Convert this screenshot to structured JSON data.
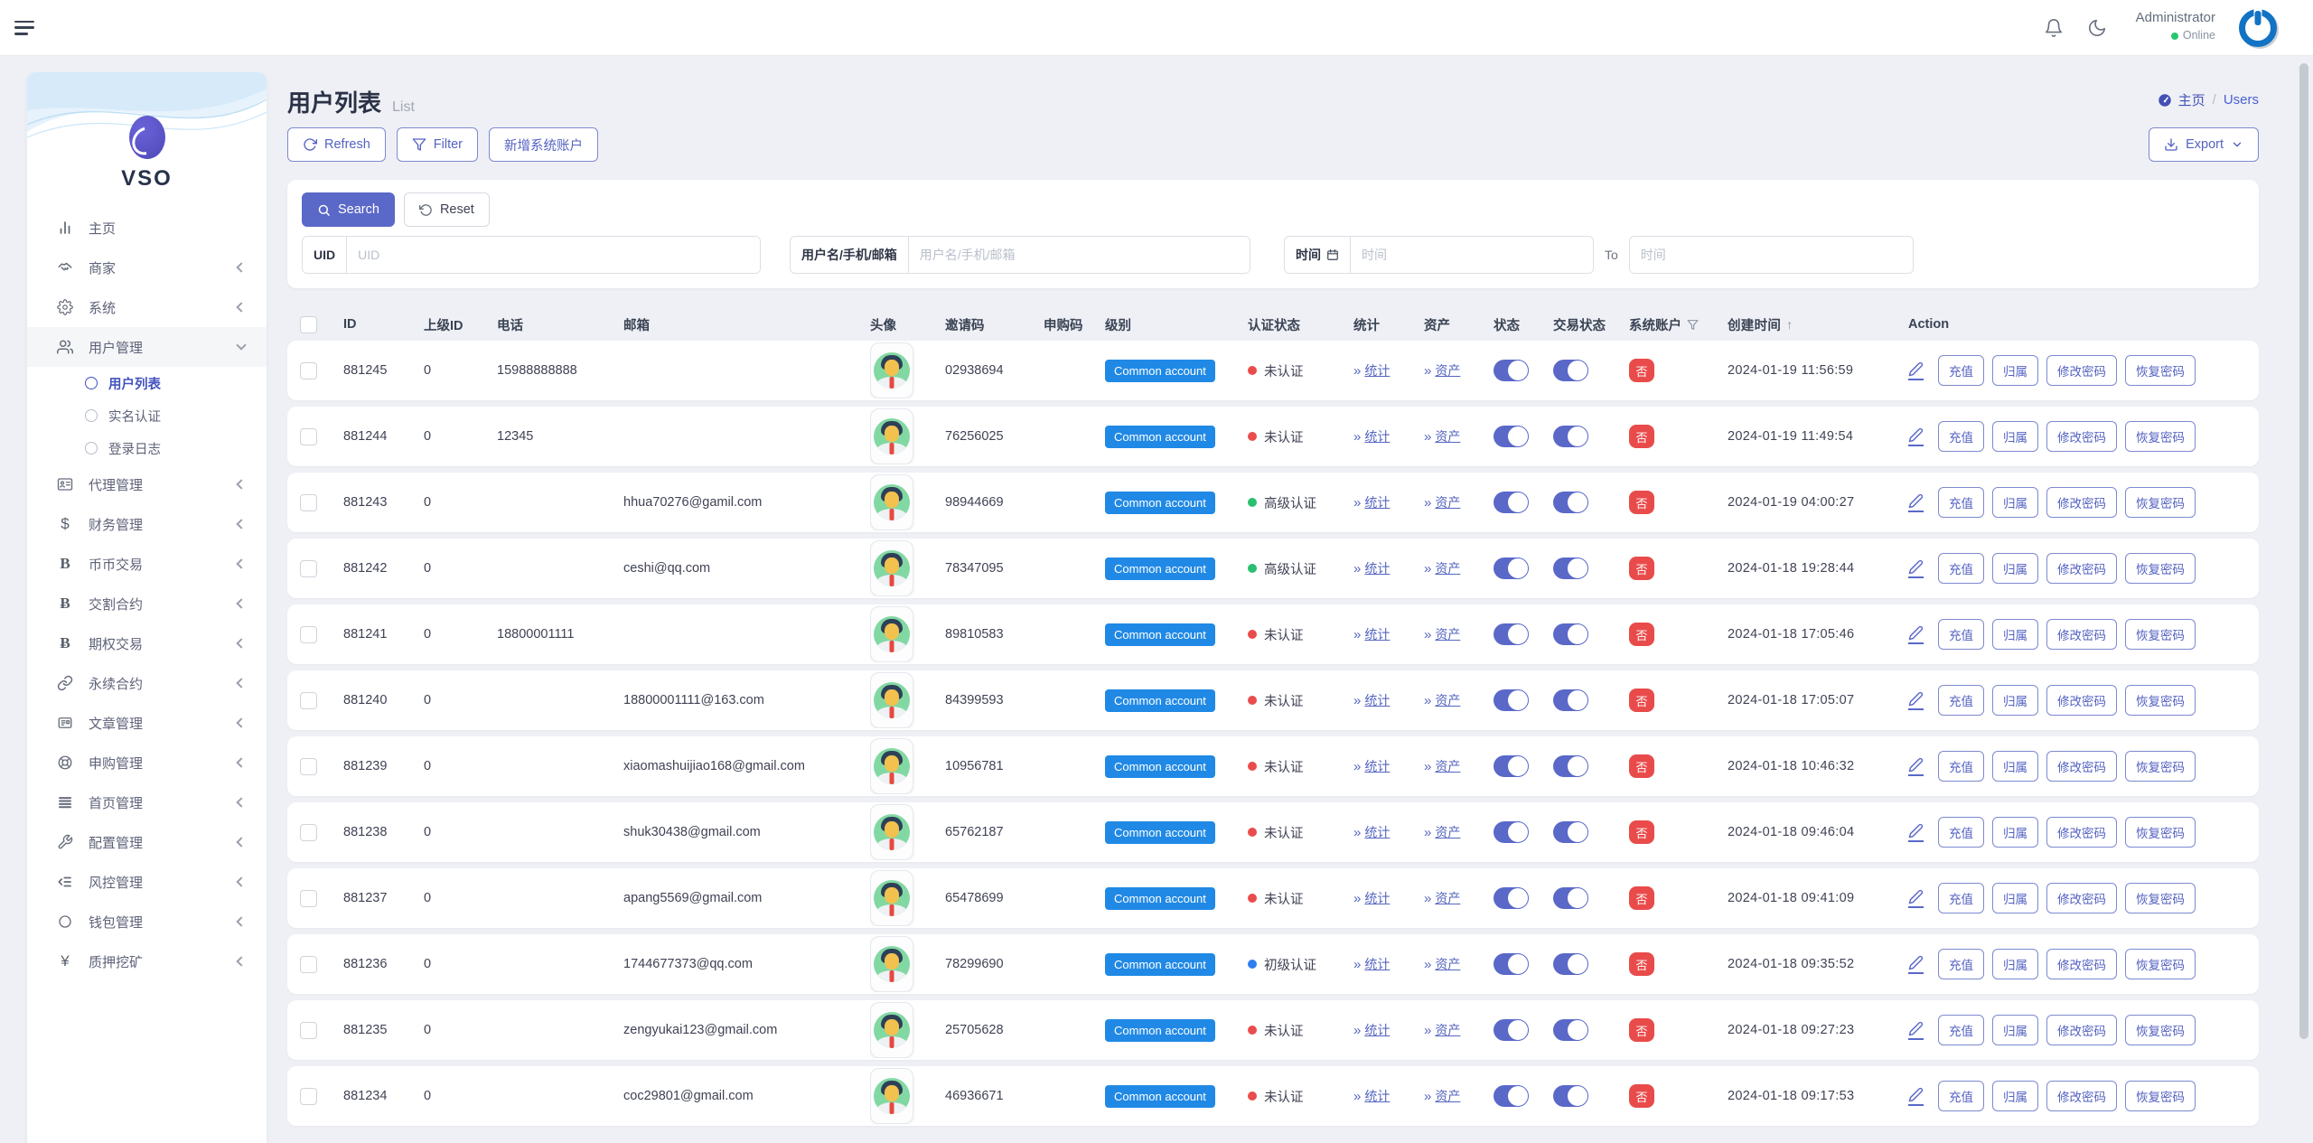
{
  "topbar": {
    "user_name": "Administrator",
    "user_status": "Online"
  },
  "sidebar": {
    "logo_text": "VSO",
    "items": [
      {
        "key": "home",
        "label": "主页",
        "icon": "bar-chart-icon",
        "chevron": null
      },
      {
        "key": "merchant",
        "label": "商家",
        "icon": "handshake-icon",
        "chevron": "left"
      },
      {
        "key": "system",
        "label": "系统",
        "icon": "gear-icon",
        "chevron": "left"
      },
      {
        "key": "user-management",
        "label": "用户管理",
        "icon": "users-icon",
        "chevron": "down",
        "active_parent": true,
        "children": [
          {
            "key": "user-list",
            "label": "用户列表",
            "active": true
          },
          {
            "key": "real-name-auth",
            "label": "实名认证",
            "active": false
          },
          {
            "key": "login-log",
            "label": "登录日志",
            "active": false
          }
        ]
      },
      {
        "key": "agent-management",
        "label": "代理管理",
        "icon": "id-card-icon",
        "chevron": "left"
      },
      {
        "key": "finance-management",
        "label": "财务管理",
        "icon": "dollar-icon",
        "chevron": "left"
      },
      {
        "key": "spot-trade",
        "label": "币币交易",
        "icon": "letter-b-icon",
        "chevron": "left"
      },
      {
        "key": "delivery-contract",
        "label": "交割合约",
        "icon": "bitcoin-icon",
        "chevron": "left"
      },
      {
        "key": "option-trade",
        "label": "期权交易",
        "icon": "bitcoin-icon",
        "chevron": "left"
      },
      {
        "key": "perpetual-contract",
        "label": "永续合约",
        "icon": "link-icon",
        "chevron": "left"
      },
      {
        "key": "article-management",
        "label": "文章管理",
        "icon": "newspaper-icon",
        "chevron": "left"
      },
      {
        "key": "subscription-management",
        "label": "申购管理",
        "icon": "life-ring-icon",
        "chevron": "left"
      },
      {
        "key": "homepage-management",
        "label": "首页管理",
        "icon": "rows-icon",
        "chevron": "left"
      },
      {
        "key": "config-management",
        "label": "配置管理",
        "icon": "wrench-icon",
        "chevron": "left"
      },
      {
        "key": "risk-management",
        "label": "风控管理",
        "icon": "indent-list-icon",
        "chevron": "left"
      },
      {
        "key": "wallet-management",
        "label": "钱包管理",
        "icon": "circle-icon",
        "chevron": "left"
      },
      {
        "key": "staking-mining",
        "label": "质押挖矿",
        "icon": "yen-icon",
        "chevron": "left"
      }
    ]
  },
  "page": {
    "title": "用户列表",
    "subtitle": "List",
    "breadcrumb_home": "主页",
    "breadcrumb_sep": "/",
    "breadcrumb_current": "Users"
  },
  "toolbar": {
    "refresh_label": "Refresh",
    "filter_label": "Filter",
    "add_system_account_label": "新增系统账户",
    "export_label": "Export"
  },
  "search": {
    "search_label": "Search",
    "reset_label": "Reset",
    "uid_label": "UID",
    "uid_placeholder": "UID",
    "uid_value": "",
    "user_label": "用户名/手机/邮箱",
    "user_placeholder": "用户名/手机/邮箱",
    "user_value": "",
    "time_label": "时间",
    "time_from_placeholder": "时间",
    "time_from_value": "",
    "to_label": "To",
    "time_to_placeholder": "时间",
    "time_to_value": ""
  },
  "table": {
    "headers": {
      "id": "ID",
      "parent_id": "上级ID",
      "phone": "电话",
      "email": "邮箱",
      "avatar": "头像",
      "invite_code": "邀请码",
      "subscribe_code": "申购码",
      "level": "级别",
      "auth_status": "认证状态",
      "stats": "统计",
      "assets": "资产",
      "status": "状态",
      "trade_status": "交易状态",
      "system_account": "系统账户",
      "created_at": "创建时间",
      "action": "Action"
    },
    "sort_arrow": "↑",
    "links": {
      "stats": "统计",
      "assets": "资产"
    },
    "link_prefix": "»",
    "level_color": "#2089e5",
    "auth_colors": {
      "未认证": "#ea4c4c",
      "初级认证": "#2d7ff0",
      "高级认证": "#2abf71"
    },
    "row_actions": [
      {
        "name": "recharge-button",
        "label": "充值"
      },
      {
        "name": "ownership-button",
        "label": "归属"
      },
      {
        "name": "change-password-button",
        "label": "修改密码"
      },
      {
        "name": "recover-password-button",
        "label": "恢复密码"
      }
    ],
    "rows": [
      {
        "id": "881245",
        "parent_id": "0",
        "phone": "15988888888",
        "email": "",
        "invite_code": "02938694",
        "subscribe_code": "",
        "level": "Common account",
        "auth_status": "未认证",
        "status_on": true,
        "trade_status_on": true,
        "system_account": "否",
        "created_at": "2024-01-19 11:56:59"
      },
      {
        "id": "881244",
        "parent_id": "0",
        "phone": "12345",
        "email": "",
        "invite_code": "76256025",
        "subscribe_code": "",
        "level": "Common account",
        "auth_status": "未认证",
        "status_on": true,
        "trade_status_on": true,
        "system_account": "否",
        "created_at": "2024-01-19 11:49:54"
      },
      {
        "id": "881243",
        "parent_id": "0",
        "phone": "",
        "email": "hhua70276@gamil.com",
        "invite_code": "98944669",
        "subscribe_code": "",
        "level": "Common account",
        "auth_status": "高级认证",
        "status_on": true,
        "trade_status_on": true,
        "system_account": "否",
        "created_at": "2024-01-19 04:00:27"
      },
      {
        "id": "881242",
        "parent_id": "0",
        "phone": "",
        "email": "ceshi@qq.com",
        "invite_code": "78347095",
        "subscribe_code": "",
        "level": "Common account",
        "auth_status": "高级认证",
        "status_on": true,
        "trade_status_on": true,
        "system_account": "否",
        "created_at": "2024-01-18 19:28:44"
      },
      {
        "id": "881241",
        "parent_id": "0",
        "phone": "18800001111",
        "email": "",
        "invite_code": "89810583",
        "subscribe_code": "",
        "level": "Common account",
        "auth_status": "未认证",
        "status_on": true,
        "trade_status_on": true,
        "system_account": "否",
        "created_at": "2024-01-18 17:05:46"
      },
      {
        "id": "881240",
        "parent_id": "0",
        "phone": "",
        "email": "18800001111@163.com",
        "invite_code": "84399593",
        "subscribe_code": "",
        "level": "Common account",
        "auth_status": "未认证",
        "status_on": true,
        "trade_status_on": true,
        "system_account": "否",
        "created_at": "2024-01-18 17:05:07"
      },
      {
        "id": "881239",
        "parent_id": "0",
        "phone": "",
        "email": "xiaomashuijiao168@gmail.com",
        "invite_code": "10956781",
        "subscribe_code": "",
        "level": "Common account",
        "auth_status": "未认证",
        "status_on": true,
        "trade_status_on": true,
        "system_account": "否",
        "created_at": "2024-01-18 10:46:32"
      },
      {
        "id": "881238",
        "parent_id": "0",
        "phone": "",
        "email": "shuk30438@gmail.com",
        "invite_code": "65762187",
        "subscribe_code": "",
        "level": "Common account",
        "auth_status": "未认证",
        "status_on": true,
        "trade_status_on": true,
        "system_account": "否",
        "created_at": "2024-01-18 09:46:04"
      },
      {
        "id": "881237",
        "parent_id": "0",
        "phone": "",
        "email": "apang5569@gmail.com",
        "invite_code": "65478699",
        "subscribe_code": "",
        "level": "Common account",
        "auth_status": "未认证",
        "status_on": true,
        "trade_status_on": true,
        "system_account": "否",
        "created_at": "2024-01-18 09:41:09"
      },
      {
        "id": "881236",
        "parent_id": "0",
        "phone": "",
        "email": "1744677373@qq.com",
        "invite_code": "78299690",
        "subscribe_code": "",
        "level": "Common account",
        "auth_status": "初级认证",
        "status_on": true,
        "trade_status_on": true,
        "system_account": "否",
        "created_at": "2024-01-18 09:35:52"
      },
      {
        "id": "881235",
        "parent_id": "0",
        "phone": "",
        "email": "zengyukai123@gmail.com",
        "invite_code": "25705628",
        "subscribe_code": "",
        "level": "Common account",
        "auth_status": "未认证",
        "status_on": true,
        "trade_status_on": true,
        "system_account": "否",
        "created_at": "2024-01-18 09:27:23"
      },
      {
        "id": "881234",
        "parent_id": "0",
        "phone": "",
        "email": "coc29801@gmail.com",
        "invite_code": "46936671",
        "subscribe_code": "",
        "level": "Common account",
        "auth_status": "未认证",
        "status_on": true,
        "trade_status_on": true,
        "system_account": "否",
        "created_at": "2024-01-18 09:17:53"
      }
    ]
  }
}
